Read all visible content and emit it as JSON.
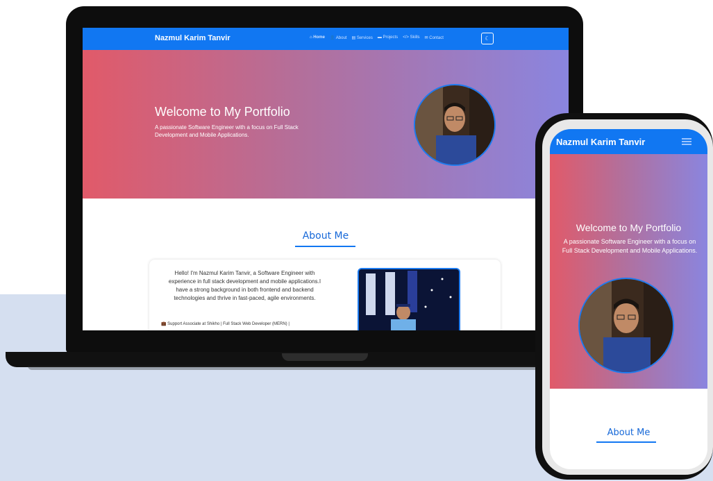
{
  "colors": {
    "navbar": "#1177f2",
    "hero_start": "#e15a69",
    "hero_end": "#8a85df",
    "accent_title": "#1668d8",
    "backdrop": "#d5dff0"
  },
  "laptop": {
    "brand": "Nazmul Karim Tanvir",
    "menu": [
      {
        "icon": "home-icon",
        "label": "Home",
        "active": true
      },
      {
        "icon": "user-icon",
        "label": "About"
      },
      {
        "icon": "services-icon",
        "label": "Services"
      },
      {
        "icon": "folder-icon",
        "label": "Projects"
      },
      {
        "icon": "code-icon",
        "label": "Skills"
      },
      {
        "icon": "mail-icon",
        "label": "Contact"
      }
    ],
    "theme_toggle_icon": "moon-icon",
    "hero": {
      "title": "Welcome to My Portfolio",
      "subtitle": "A passionate Software Engineer with a focus on Full Stack Development and Mobile Applications."
    },
    "about": {
      "title": "About Me",
      "text": "Hello! I'm Nazmul Karim Tanvir, a Software Engineer with experience in full stack development and mobile applications.I have a strong background in both frontend and backend technologies and thrive in fast-paced, agile environments.",
      "job": "Support Associate at Shikho | Full Stack Web Developer (MERN) |"
    }
  },
  "phone": {
    "brand": "Nazmul Karim Tanvir",
    "menu_icon": "hamburger-icon",
    "hero": {
      "title": "Welcome to My Portfolio",
      "subtitle": "A passionate Software Engineer with a focus on Full Stack Development and Mobile Applications."
    },
    "about_title": "About Me"
  }
}
